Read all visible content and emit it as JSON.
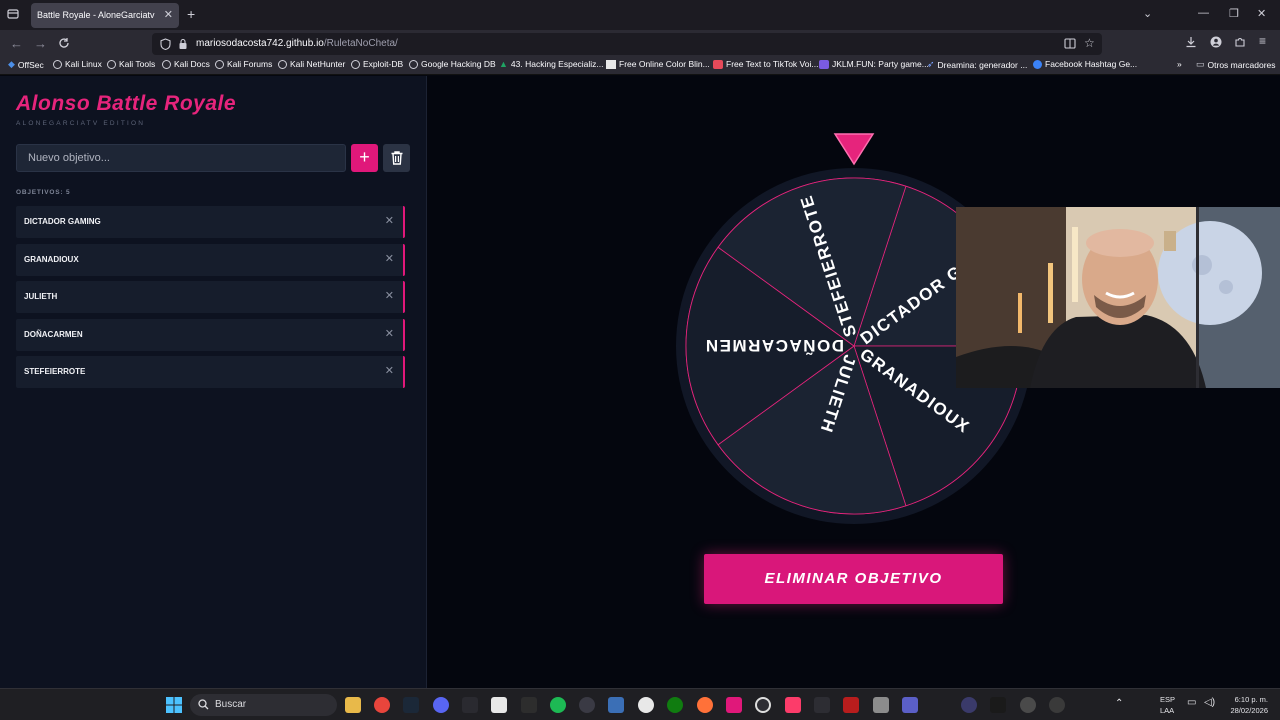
{
  "browser": {
    "tab_title": "Battle Royale - AloneGarciatv",
    "url_host": "mariosodacosta742.github.io",
    "url_path": "/RuletaNoCheta/",
    "bookmarks": [
      {
        "label": "OffSec"
      },
      {
        "label": "Kali Linux"
      },
      {
        "label": "Kali Tools"
      },
      {
        "label": "Kali Docs"
      },
      {
        "label": "Kali Forums"
      },
      {
        "label": "Kali NetHunter"
      },
      {
        "label": "Exploit-DB"
      },
      {
        "label": "Google Hacking DB"
      },
      {
        "label": "43. Hacking Especializ..."
      },
      {
        "label": "Free Online Color Blin..."
      },
      {
        "label": "Free Text to TikTok Voi..."
      },
      {
        "label": "JKLM.FUN: Party game..."
      },
      {
        "label": "Dreamina: generador ..."
      },
      {
        "label": "Facebook Hashtag Ge..."
      }
    ],
    "other_bookmarks": "Otros marcadores"
  },
  "app": {
    "title": "Alonso Battle Royale",
    "subtitle": "ALONEGARCIATV EDITION",
    "input_placeholder": "Nuevo objetivo...",
    "add_label": "+",
    "count_label": "OBJETIVOS: 5",
    "items": [
      {
        "label": "DICTADOR GAMING"
      },
      {
        "label": "GRANADIOUX"
      },
      {
        "label": "JULIETH"
      },
      {
        "label": "DOÑACARMEN"
      },
      {
        "label": "STEFEIERROTE"
      }
    ],
    "wheel_segments": [
      "DICTADOR GAMING",
      "GRANADIOUX",
      "JULIETH",
      "DOÑACARMEN",
      "STEFEIERROTE"
    ],
    "cta_label": "ELIMINAR OBJETIVO",
    "colors": {
      "accent": "#e0187a",
      "sidebar": "#0d1220",
      "wheel": "#1a2231"
    }
  },
  "taskbar": {
    "search_label": "Buscar",
    "lang": "ESP",
    "lang_sub": "LAA",
    "time": "6:10 p. m.",
    "date": "28/02/2026"
  }
}
